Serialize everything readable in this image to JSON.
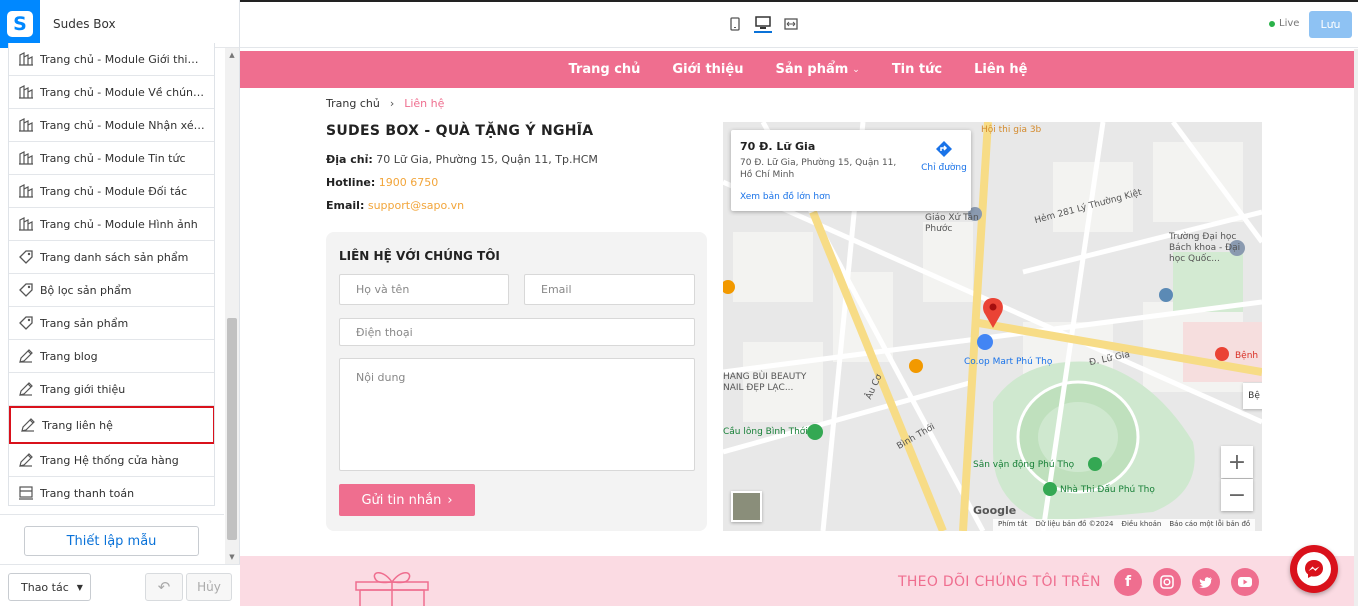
{
  "app": {
    "title": "Sudes Box",
    "logo_letter": "S"
  },
  "sidebar": {
    "items": [
      {
        "label": "Trang chủ - Module Giới thiệu ...",
        "icon": "layout-icon"
      },
      {
        "label": "Trang chủ - Module Về chúng ...",
        "icon": "layout-icon"
      },
      {
        "label": "Trang chủ - Module Nhận xét ...",
        "icon": "layout-icon"
      },
      {
        "label": "Trang chủ - Module Tin tức",
        "icon": "layout-icon"
      },
      {
        "label": "Trang chủ - Module Đối tác",
        "icon": "layout-icon"
      },
      {
        "label": "Trang chủ - Module Hình ảnh",
        "icon": "layout-icon"
      },
      {
        "label": "Trang danh sách sản phẩm",
        "icon": "tag-icon"
      },
      {
        "label": "Bộ lọc sản phẩm",
        "icon": "tag-icon"
      },
      {
        "label": "Trang sản phẩm",
        "icon": "tag-icon"
      },
      {
        "label": "Trang blog",
        "icon": "pen-icon"
      },
      {
        "label": "Trang giới thiệu",
        "icon": "pen-icon"
      },
      {
        "label": "Trang liên hệ",
        "icon": "pen-icon",
        "selected": true
      },
      {
        "label": "Trang Hệ thống cửa hàng",
        "icon": "pen-icon"
      },
      {
        "label": "Trang thanh toán",
        "icon": "checkout-icon"
      }
    ],
    "setup_button": "Thiết lập mẫu",
    "actions_button": "Thao tác",
    "redo_button": "Hủy"
  },
  "topbar": {
    "live_label": "Live",
    "save_label": "Lưu",
    "live_color": "#2ab24a"
  },
  "site": {
    "nav": [
      "Trang chủ",
      "Giới thiệu",
      "Sản phẩm",
      "Tin tức",
      "Liên hệ"
    ],
    "breadcrumb": {
      "home": "Trang chủ",
      "current": "Liên hệ"
    },
    "shop_name": "SUDES BOX - QUÀ TẶNG Ý NGHĨA",
    "address_label": "Địa chỉ:",
    "address": "70 Lữ Gia, Phường 15, Quận 11, Tp.HCM",
    "hotline_label": "Hotline:",
    "hotline": "1900 6750",
    "email_label": "Email:",
    "email": "support@sapo.vn",
    "form": {
      "title": "LIÊN HỆ VỚI CHÚNG TÔI",
      "name_placeholder": "Họ và tên",
      "email_placeholder": "Email",
      "phone_placeholder": "Điện thoại",
      "message_placeholder": "Nội dung",
      "send_label": "Gửi tin nhắn"
    },
    "map": {
      "card_title": "70 Đ. Lữ Gia",
      "card_address": "70 Đ. Lữ Gia, Phường 15, Quận 11, Hồ Chí Minh",
      "directions": "Chỉ đường",
      "larger_map": "Xem bản đồ lớn hơn",
      "labels": {
        "coop": "Co.op Mart Phú Thọ",
        "stadium": "Sân vận động Phú Thọ",
        "gym": "Nhà Thi Đấu Phú Thọ",
        "church": "Nhà Thờ Giáo Xứ Tân Phước",
        "bach_khoa": "Trường Đại học Bách khoa - Đại học Quốc...",
        "lu_gia": "Đ. Lữ Gia",
        "binh_thoi": "Bình Thới",
        "au_co": "Âu Cơ",
        "hem_281": "Hẻm 281 Lý Thường Kiệt",
        "beauty": "HANG BÙI BEAUTY NAIL ĐẸP LẠC...",
        "cau_long": "Cầu lông Bình Thới",
        "hospital": "Bệnh",
        "top_label": "Hội thi gia 3b",
        "side_tab": "Bệ"
      },
      "footer": [
        "Phím tắt",
        "Dữ liệu bản đồ ©2024",
        "Điều khoản",
        "Báo cáo một lỗi bản đồ"
      ],
      "google": "Google"
    },
    "follow_text": "THEO DÕI CHÚNG TÔI TRÊN",
    "accent": "#ef6e8f"
  }
}
